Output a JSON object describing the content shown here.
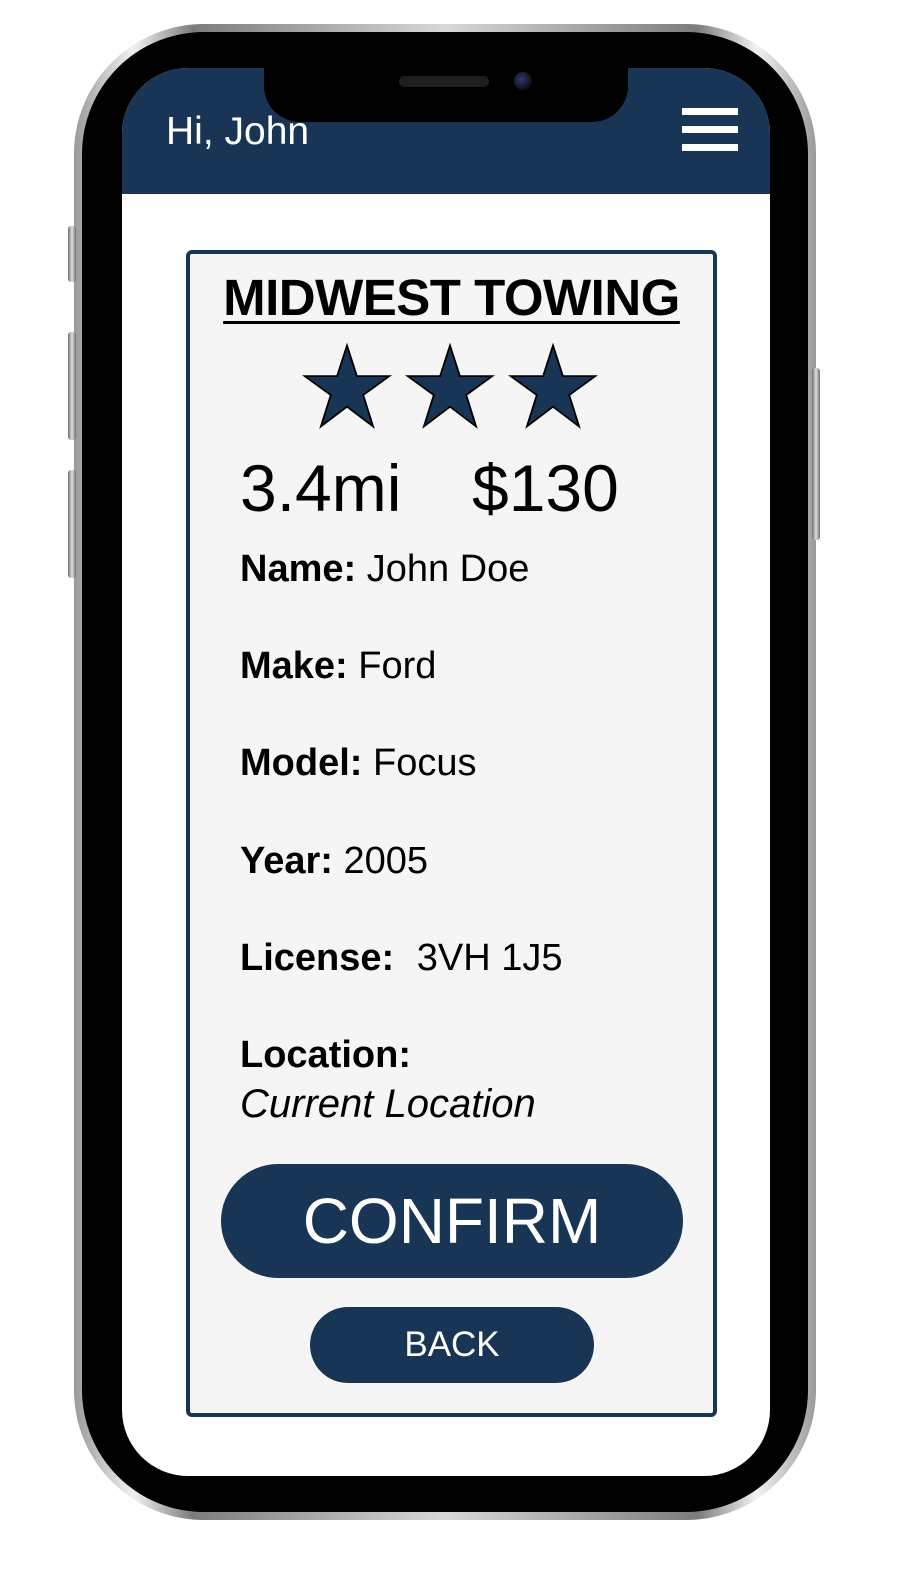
{
  "header": {
    "greeting": "Hi, John",
    "menu_icon": "hamburger-menu-icon",
    "background_color": "#193556"
  },
  "provider": {
    "name": "MIDWEST TOWING",
    "rating": 3,
    "rating_icon": "star-icon",
    "distance": "3.4mi",
    "price": "$130"
  },
  "details": {
    "name": {
      "label": "Name:",
      "value": "John Doe"
    },
    "make": {
      "label": "Make:",
      "value": "Ford"
    },
    "model": {
      "label": "Model:",
      "value": "Focus"
    },
    "year": {
      "label": "Year:",
      "value": "2005"
    },
    "license": {
      "label": "License:",
      "value": "3VH 1J5"
    },
    "location": {
      "label": "Location:",
      "value": "Current Location"
    }
  },
  "actions": {
    "confirm_label": "CONFIRM",
    "back_label": "BACK"
  },
  "colors": {
    "primary": "#193556",
    "card_background": "#f5f5f6",
    "text": "#000000"
  }
}
